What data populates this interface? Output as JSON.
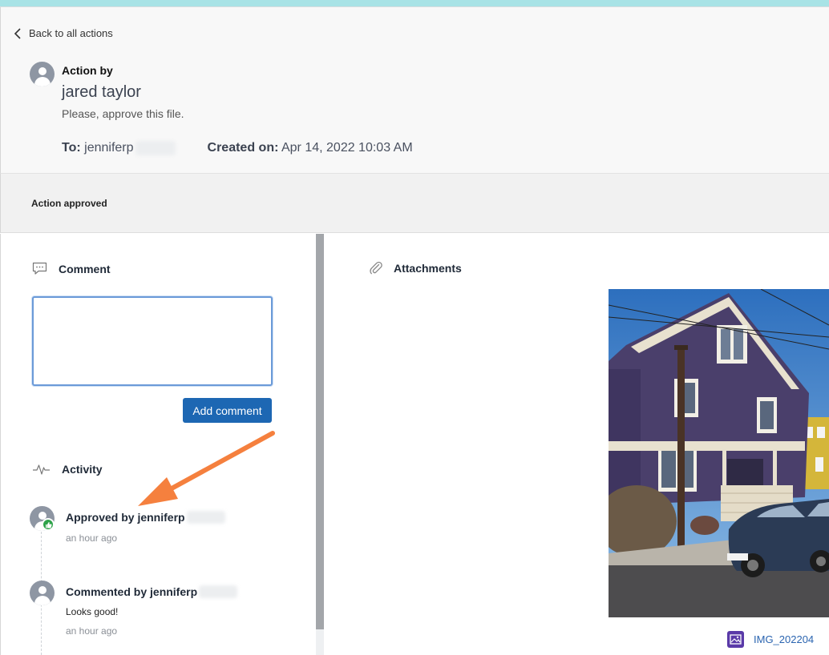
{
  "header": {
    "back_label": "Back to all actions",
    "action_by_label": "Action by",
    "actor_name": "jared taylor",
    "request_text": "Please, approve this file.",
    "to_label": "To:",
    "to_value": "jenniferp",
    "created_label": "Created on:",
    "created_value": "Apr 14, 2022 10:03 AM"
  },
  "status": {
    "text": "Action approved"
  },
  "comment": {
    "title": "Comment",
    "input_value": "",
    "button_label": "Add comment"
  },
  "activity": {
    "title": "Activity",
    "items": [
      {
        "title": "Approved by jenniferp",
        "time": "an hour ago",
        "badge": "thumbs-up-icon"
      },
      {
        "title": "Commented by jenniferp",
        "comment": "Looks good!",
        "time": "an hour ago"
      }
    ]
  },
  "attachments": {
    "title": "Attachments",
    "file_name": "IMG_202204"
  },
  "colors": {
    "accent_bar": "#a8e3e6",
    "primary_button": "#1d67b3",
    "approved_badge": "#2fa34a",
    "annotation_arrow": "#f5803e",
    "file_icon": "#5a3aa8",
    "link": "#2a64b0"
  }
}
